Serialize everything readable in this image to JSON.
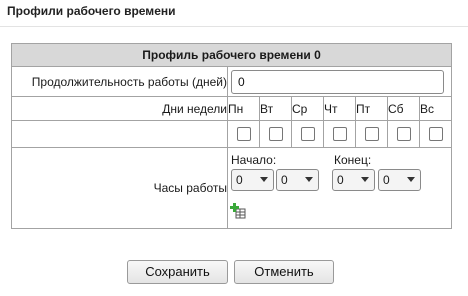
{
  "page": {
    "title": "Профили рабочего времени"
  },
  "profile": {
    "header": "Профиль рабочего времени 0",
    "duration_label": "Продолжительность работы (дней)",
    "duration_value": "0",
    "days_label": "Дни недели",
    "days": [
      "Пн",
      "Вт",
      "Ср",
      "Чт",
      "Пт",
      "Сб",
      "Вс"
    ],
    "days_checked": [
      false,
      false,
      false,
      false,
      false,
      false,
      false
    ],
    "hours_label": "Часы работы",
    "start_label": "Начало:",
    "end_label": "Конец:",
    "start_hour": "0",
    "start_minute": "0",
    "end_hour": "0",
    "end_minute": "0",
    "add_icon": "add-interval-icon"
  },
  "buttons": {
    "save": "Сохранить",
    "cancel": "Отменить"
  },
  "colors": {
    "header_bg": "#d8d8d8",
    "border": "#a3a3a3",
    "add_icon_green": "#3aa83a"
  }
}
